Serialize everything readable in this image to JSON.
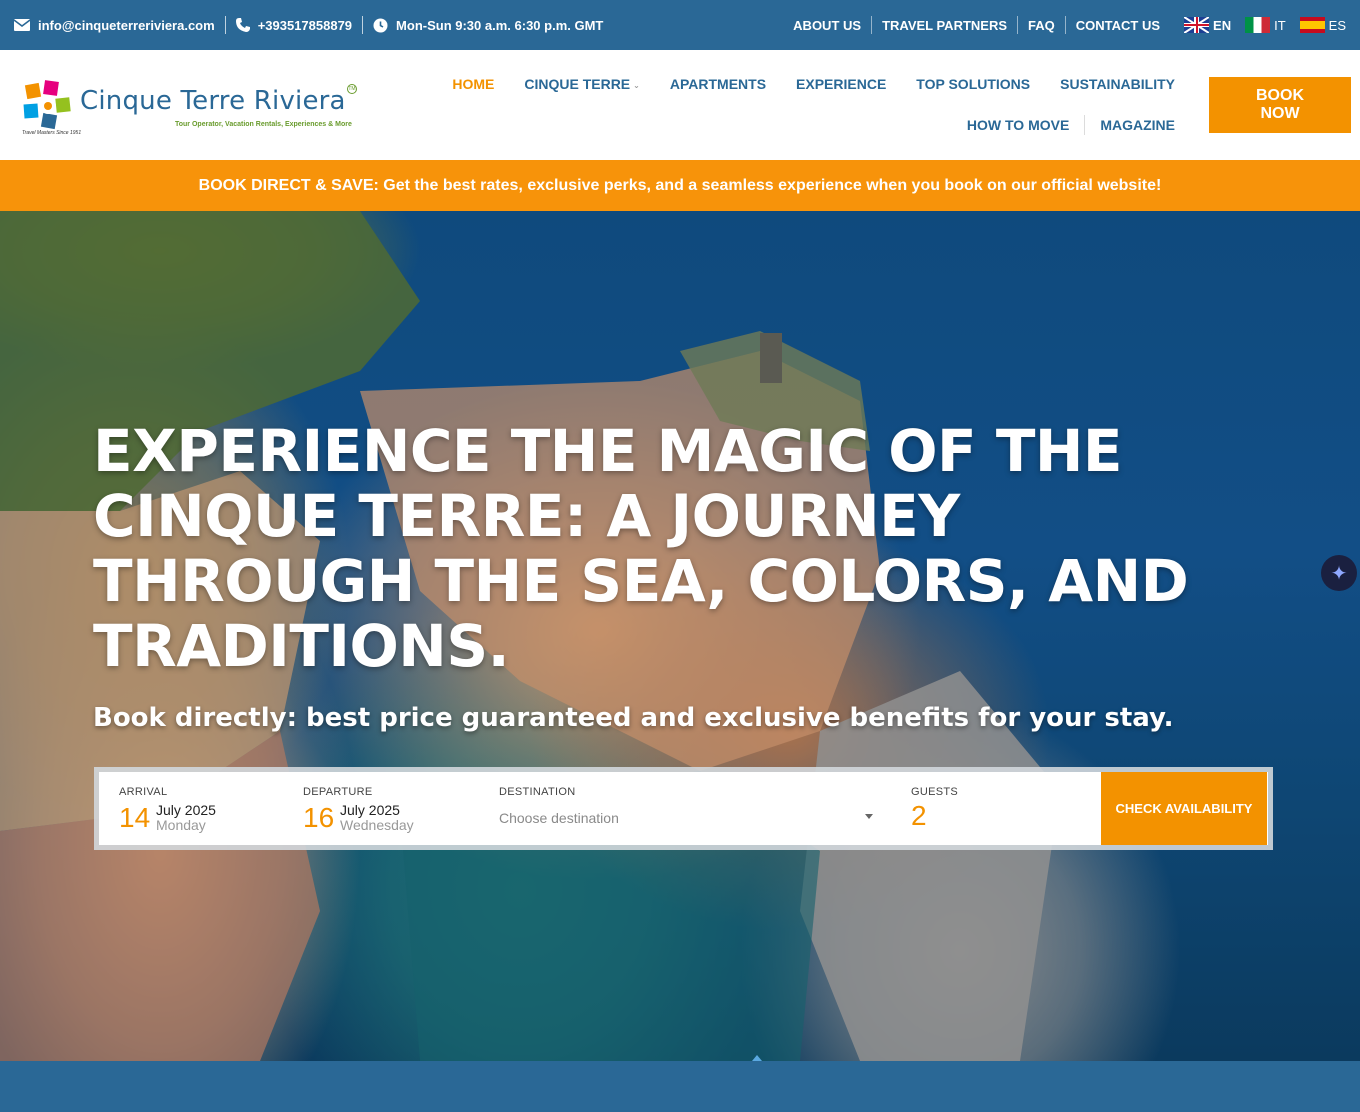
{
  "topbar": {
    "email": "info@cinqueterreriviera.com",
    "phone": "+393517858879",
    "hours": "Mon-Sun 9:30 a.m. 6:30 p.m. GMT",
    "links": [
      "ABOUT US",
      "TRAVEL PARTNERS",
      "FAQ",
      "CONTACT US"
    ],
    "languages": [
      {
        "code": "EN",
        "flag": "uk-flag"
      },
      {
        "code": "IT",
        "flag": "italy-flag"
      },
      {
        "code": "ES",
        "flag": "spain-flag"
      }
    ]
  },
  "logo": {
    "name": "Cinque Terre Riviera",
    "tagline": "Tour Operator, Vacation Rentals, Experiences & More",
    "since": "Travel Masters Since 1951",
    "tm": "TM"
  },
  "nav": {
    "row1": [
      "HOME",
      "CINQUE TERRE",
      "APARTMENTS",
      "EXPERIENCE",
      "TOP SOLUTIONS",
      "SUSTAINABILITY"
    ],
    "row2": [
      "HOW TO MOVE",
      "MAGAZINE"
    ],
    "book_label": "BOOK NOW"
  },
  "promo": {
    "text": "BOOK DIRECT & SAVE: Get the best rates, exclusive perks, and a seamless experience when you book on our official website!"
  },
  "hero": {
    "title": "EXPERIENCE THE MAGIC OF THE CINQUE TERRE: A JOURNEY THROUGH THE SEA, COLORS, AND TRADITIONS.",
    "subtitle": "Book directly: best price guaranteed and exclusive benefits for your stay."
  },
  "booking": {
    "arrival_label": "ARRIVAL",
    "arrival_day": "14",
    "arrival_month": "July 2025",
    "arrival_weekday": "Monday",
    "departure_label": "DEPARTURE",
    "departure_day": "16",
    "departure_month": "July 2025",
    "departure_weekday": "Wednesday",
    "destination_label": "DESTINATION",
    "destination_placeholder": "Choose destination",
    "guests_label": "GUESTS",
    "guests_value": "2",
    "check_label": "CHECK AVAILABILITY"
  },
  "colors": {
    "brand_blue": "#2a6896",
    "accent_orange": "#f39200"
  }
}
